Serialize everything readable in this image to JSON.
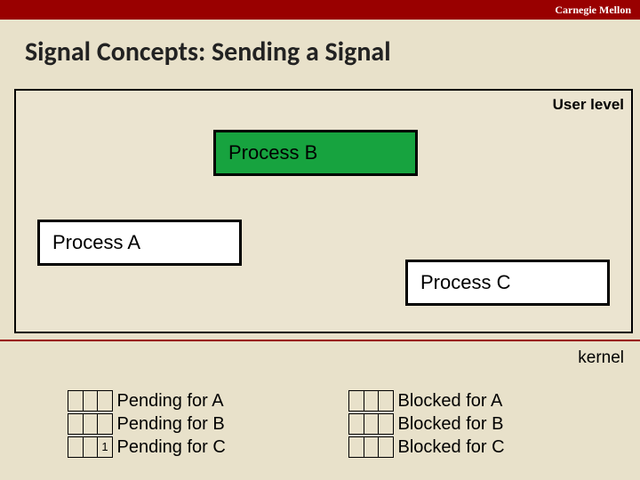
{
  "header": {
    "org": "Carnegie Mellon"
  },
  "title": "Signal Concepts: Sending a Signal",
  "labels": {
    "user": "User level",
    "kernel": "kernel"
  },
  "processes": {
    "a": "Process A",
    "b": "Process B",
    "c": "Process C"
  },
  "pending": {
    "rows": [
      {
        "bits": [
          "",
          "",
          ""
        ],
        "label": "Pending for A"
      },
      {
        "bits": [
          "",
          "",
          ""
        ],
        "label": "Pending for B"
      },
      {
        "bits": [
          "",
          "",
          "1"
        ],
        "label": "Pending for C"
      }
    ]
  },
  "blocked": {
    "rows": [
      {
        "bits": [
          "",
          "",
          ""
        ],
        "label": "Blocked for A"
      },
      {
        "bits": [
          "",
          "",
          ""
        ],
        "label": "Blocked for B"
      },
      {
        "bits": [
          "",
          "",
          ""
        ],
        "label": "Blocked for C"
      }
    ]
  }
}
